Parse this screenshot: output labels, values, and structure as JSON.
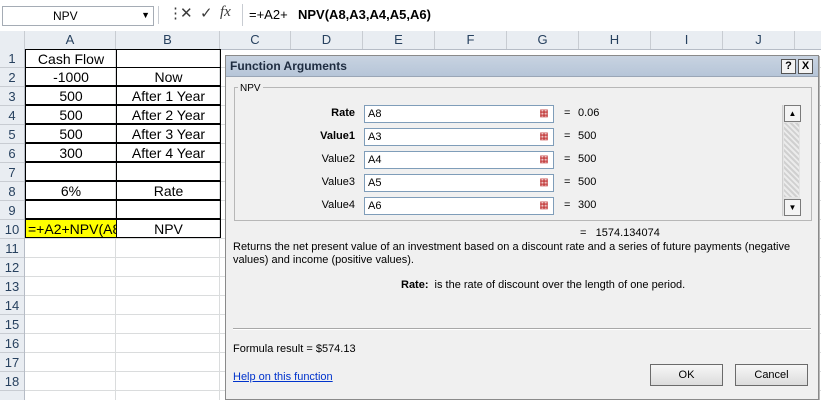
{
  "formula_bar": {
    "name_box": "NPV",
    "cancel_icon": "cancel-x-icon",
    "enter_icon": "checkmark-icon",
    "fx_label": "fx",
    "formula_prefix": "=+A2+",
    "formula_bold": "NPV(A8,A3,A4,A5,A6)"
  },
  "columns": [
    "A",
    "B",
    "C",
    "D",
    "E",
    "F",
    "G",
    "H",
    "I",
    "J"
  ],
  "rows": [
    "1",
    "2",
    "3",
    "4",
    "5",
    "6",
    "7",
    "8",
    "9",
    "10",
    "11",
    "12",
    "13",
    "14",
    "15",
    "16",
    "17",
    "18"
  ],
  "sheet": {
    "A1": "Cash Flow",
    "A2": "-1000",
    "B2": "Now",
    "A3": "500",
    "B3": "After 1 Year",
    "A4": "500",
    "B4": "After 2 Year",
    "A5": "500",
    "B5": "After 3 Year",
    "A6": "300",
    "B6": "After 4 Year",
    "A8": "6%",
    "B8": "Rate",
    "A10": "=+A2+NPV(A8",
    "B10": "NPV"
  },
  "dialog": {
    "title": "Function Arguments",
    "help_btn": "?",
    "close_btn": "X",
    "group_label": "NPV",
    "args": [
      {
        "label": "Rate",
        "ref": "A8",
        "value": "0.06"
      },
      {
        "label": "Value1",
        "ref": "A3",
        "value": "500"
      },
      {
        "label": "Value2",
        "ref": "A4",
        "value": "500"
      },
      {
        "label": "Value3",
        "ref": "A5",
        "value": "500"
      },
      {
        "label": "Value4",
        "ref": "A6",
        "value": "300"
      }
    ],
    "eq": "=",
    "total": "1574.134074",
    "description": "Returns the net present value of an investment based on a discount rate and a series of future payments (negative values) and income (positive values).",
    "rate_label": "Rate:",
    "rate_text": "is the rate of discount over the length of one period.",
    "formula_result": "Formula result =    $574.13",
    "help_link": "Help on this function",
    "ok": "OK",
    "cancel": "Cancel"
  },
  "colors": {
    "highlight_cell": "#ffff00",
    "header_bg": "#e9edf2",
    "dialog_title": "#b6c5d8"
  }
}
